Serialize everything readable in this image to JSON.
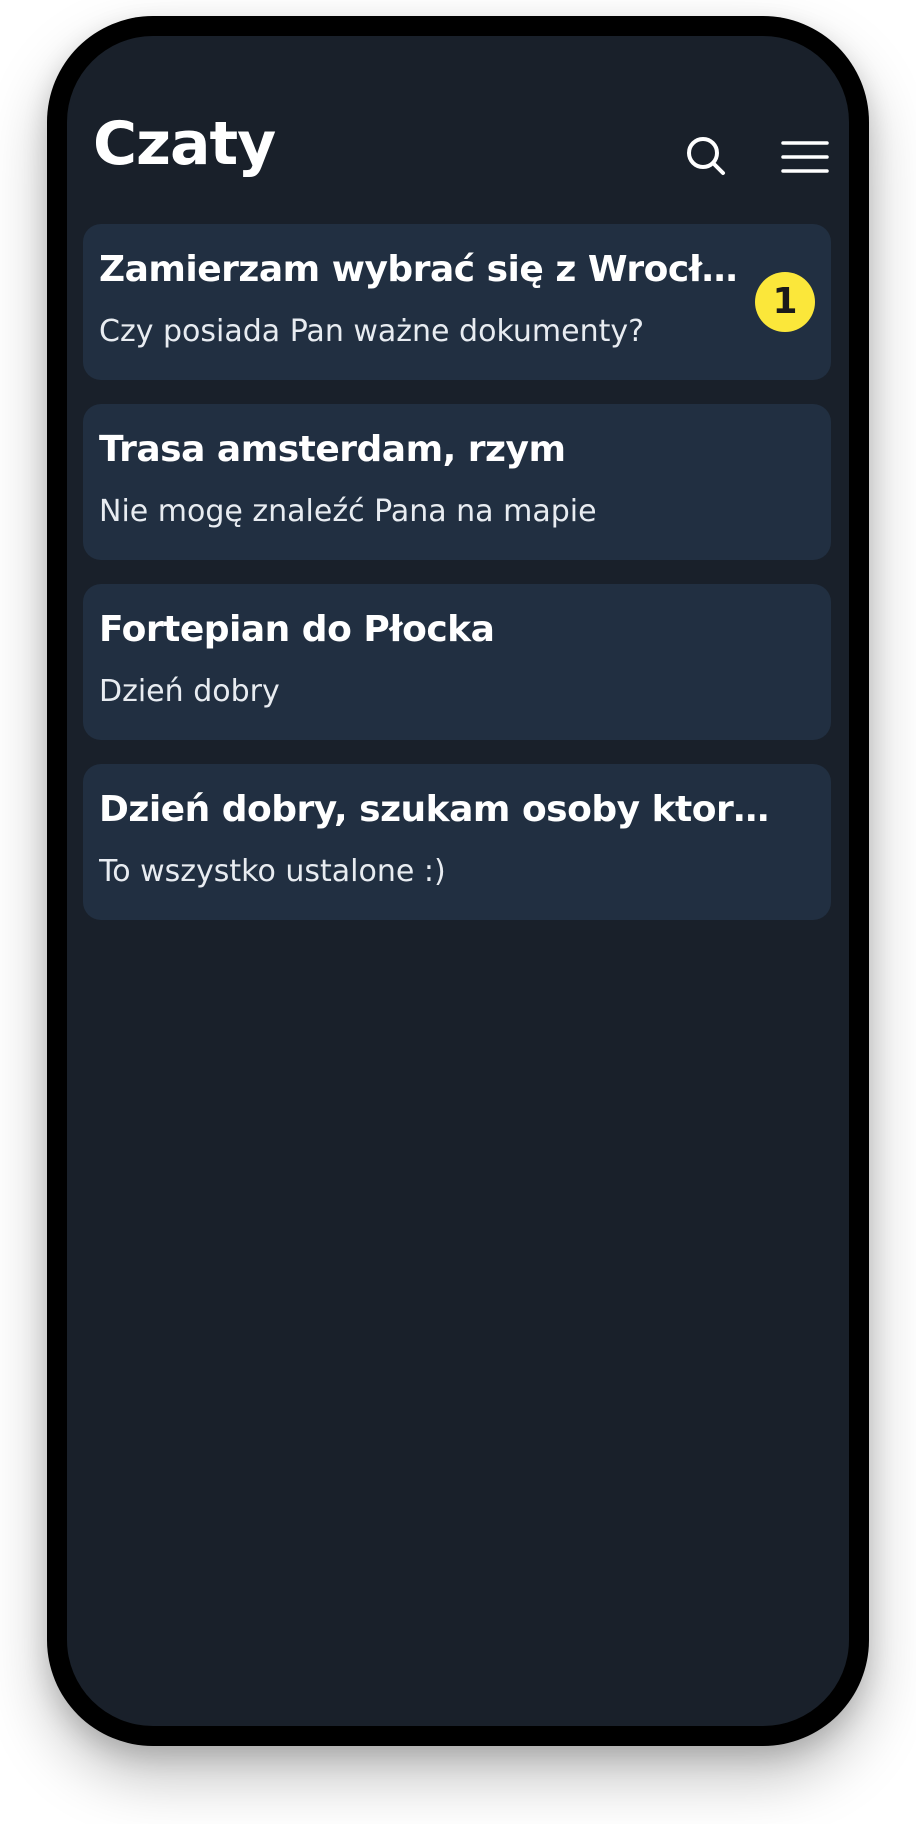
{
  "header": {
    "title": "Czaty",
    "search_icon": "search-icon",
    "menu_icon": "hamburger-menu-icon"
  },
  "chats": [
    {
      "title": "Zamierzam wybrać się z Wrocła…",
      "preview": "Czy posiada Pan ważne dokumenty?",
      "unread": "1"
    },
    {
      "title": "Trasa amsterdam, rzym",
      "preview": "Nie mogę znaleźć Pana na mapie"
    },
    {
      "title": "Fortepian do Płocka",
      "preview": "Dzień dobry"
    },
    {
      "title": "Dzień dobry, szukam osoby ktora za…",
      "preview": "To wszystko ustalone :)"
    }
  ],
  "colors": {
    "background": "#19202a",
    "card": "#212f41",
    "badge": "#fbe73a",
    "text": "#ffffff"
  }
}
